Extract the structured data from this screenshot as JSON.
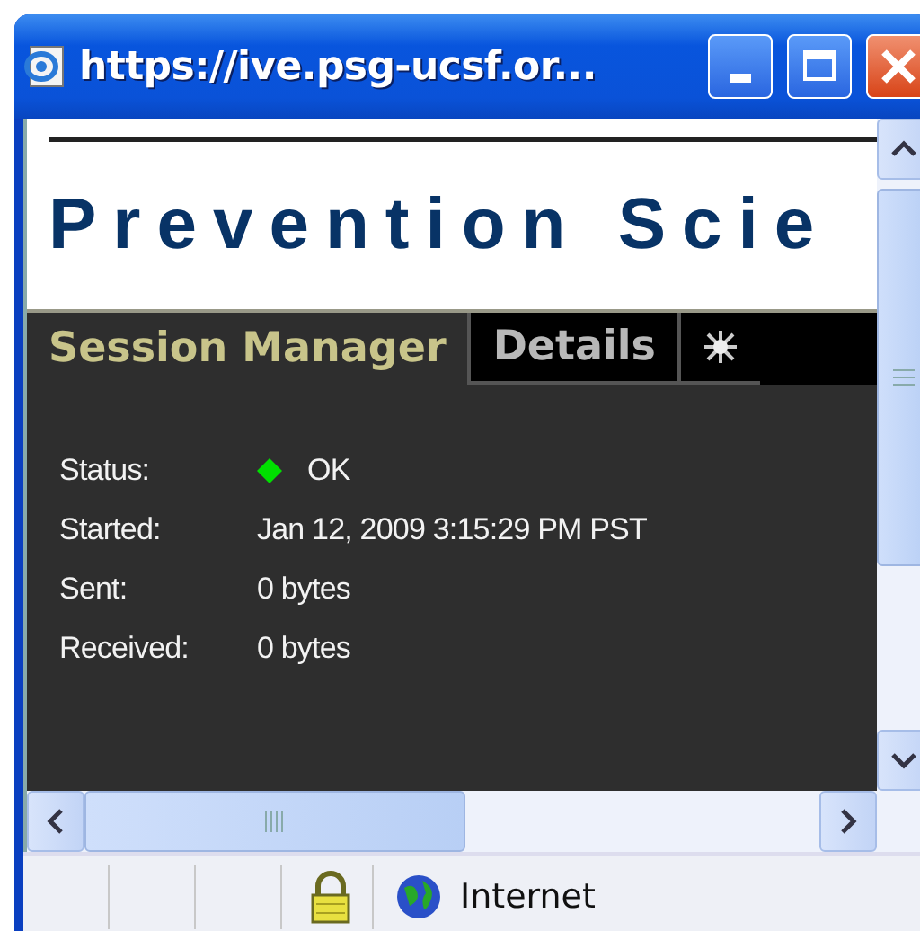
{
  "window": {
    "title": "https://ive.psg-ucsf.or..."
  },
  "heading": "Prevention Scie",
  "tabs": [
    {
      "kind": "text",
      "label": "Session Manager",
      "selected": true
    },
    {
      "kind": "text",
      "label": "Details",
      "selected": false
    },
    {
      "kind": "icon",
      "selected": false
    }
  ],
  "fields": [
    {
      "label": "Status:",
      "value": "OK",
      "color": "#00e000"
    },
    {
      "label": "Started:",
      "value": "Jan 12, 2009 3:15:29 PM PST"
    },
    {
      "label": "Sent:",
      "value": "0 bytes"
    },
    {
      "label": "Received:",
      "value": "0 bytes"
    }
  ],
  "status_bar": {
    "secure": true,
    "zone": "Internet"
  }
}
